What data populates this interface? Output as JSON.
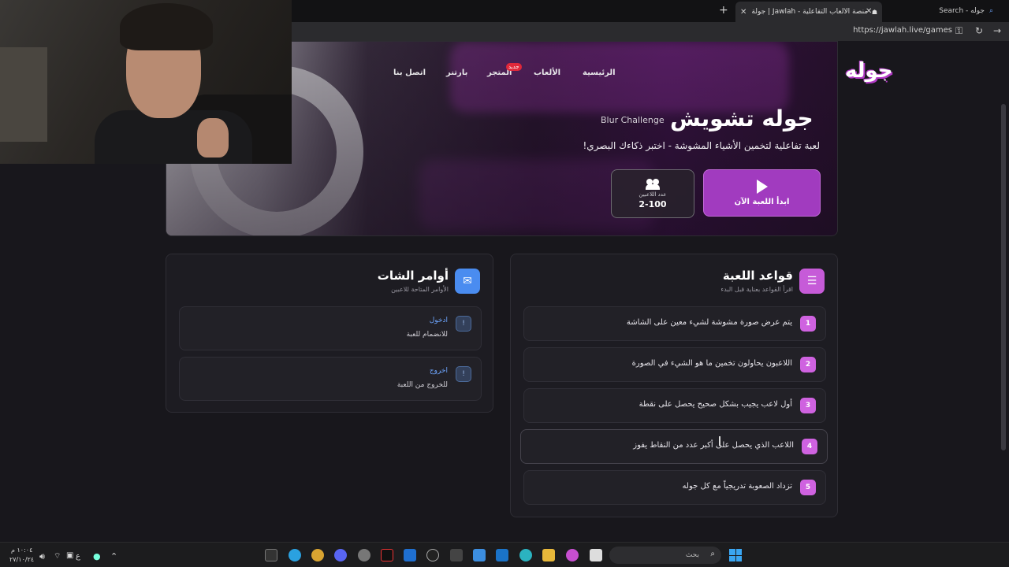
{
  "browser": {
    "active_tab_title": "جولة | Jawlah - منصة الألعاب التفاعلية",
    "other_tab_title": "Search - جوله",
    "url": "https://jawlah.live/games"
  },
  "site": {
    "logo_text": "جوله",
    "nav": {
      "home": "الرئيسية",
      "games": "الألعاب",
      "store": "المتجر",
      "store_badge": "جديد",
      "partner": "بارتنر",
      "contact": "اتصل بنا"
    },
    "hero": {
      "title": "جوله تشويش",
      "subtitle_en": "Blur Challenge",
      "description": "لعبة تفاعلية لتخمين الأشياء المشوشة - اختبر ذكاءك البصري!",
      "play_button": "ابدأ اللعبة الآن",
      "players_label": "عدد اللاعبين",
      "players_value": "2-100"
    },
    "rules": {
      "title": "قواعد اللعبة",
      "subtitle": "اقرأ القواعد بعناية قبل البدء",
      "items": [
        {
          "num": "1",
          "text": "يتم عرض صورة مشوشة لشيء معين على الشاشة"
        },
        {
          "num": "2",
          "text": "اللاعبون يحاولون تخمين ما هو الشيء في الصورة"
        },
        {
          "num": "3",
          "text": "أول لاعب يجيب بشكل صحيح يحصل على نقطة"
        },
        {
          "num": "4",
          "text": "اللاعب الذي يحصل على أكبر عدد من النقاط يفوز"
        },
        {
          "num": "5",
          "text": "تزداد الصعوبة تدريجياً مع كل جوله"
        }
      ]
    },
    "chat": {
      "title": "أوامر الشات",
      "subtitle": "الأوامر المتاحة للاعبين",
      "commands": [
        {
          "icon": "!",
          "name": "ادخول",
          "desc": "للانضمام للعبة"
        },
        {
          "icon": "!",
          "name": "اخروج",
          "desc": "للخروج من اللعبة"
        }
      ]
    }
  },
  "taskbar": {
    "search_placeholder": "بحث",
    "time": "١٠:٠٤ م",
    "date": "٢٧/١٠/٢٤",
    "lang": "ع"
  },
  "colors": {
    "accent": "#a13bbf",
    "rule_num": "#cf62e0",
    "link_blue": "#6ea6ff",
    "background": "#18171c"
  }
}
